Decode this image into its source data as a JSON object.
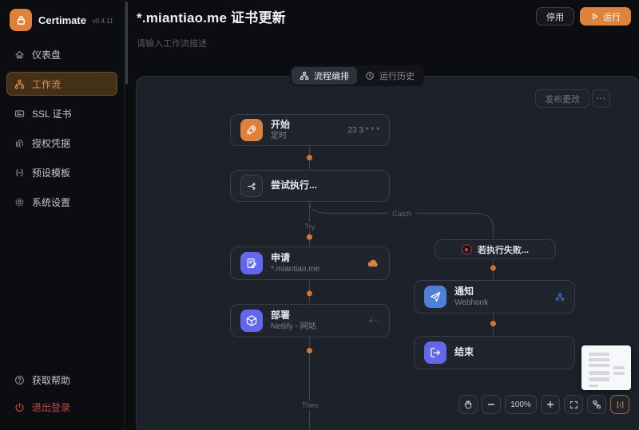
{
  "app": {
    "name": "Certimate",
    "version": "v0.4.11"
  },
  "sidebar": {
    "items": [
      {
        "label": "仪表盘",
        "icon": "home-icon",
        "active": false
      },
      {
        "label": "工作流",
        "icon": "workflow-icon",
        "active": true
      },
      {
        "label": "SSL 证书",
        "icon": "certificate-icon",
        "active": false
      },
      {
        "label": "授权凭据",
        "icon": "credentials-icon",
        "active": false
      },
      {
        "label": "预设模板",
        "icon": "template-icon",
        "active": false
      },
      {
        "label": "系统设置",
        "icon": "settings-icon",
        "active": false
      }
    ],
    "footer": [
      {
        "label": "获取帮助",
        "icon": "help-icon"
      },
      {
        "label": "退出登录",
        "icon": "logout-icon"
      }
    ]
  },
  "header": {
    "title": "*.miantiao.me 证书更新",
    "description": "请输入工作流描述",
    "disable_button": "停用",
    "run_button": "运行"
  },
  "tabs": [
    {
      "label": "流程编排",
      "active": true
    },
    {
      "label": "运行历史",
      "active": false
    }
  ],
  "canvas": {
    "publish_button": "发布更改",
    "more_button": "···",
    "zoom_level": "100%",
    "labels": {
      "try": "Try",
      "catch": "Catch",
      "then": "Then"
    },
    "nodes": {
      "start": {
        "title": "开始",
        "subtitle": "定时",
        "meta": "23 3 * * *"
      },
      "try_block": {
        "title": "尝试执行..."
      },
      "apply": {
        "title": "申请",
        "subtitle": "*.miantiao.me"
      },
      "deploy": {
        "title": "部署",
        "subtitle": "Netlify - 网站"
      },
      "on_failure": {
        "title": "若执行失败..."
      },
      "notify": {
        "title": "通知",
        "subtitle": "Webhook"
      },
      "end": {
        "title": "结束"
      }
    }
  },
  "colors": {
    "accent_orange": "#e0823a",
    "indigo_node": "#6366ef",
    "blue_node": "#4f80d9",
    "canvas_bg": "#1d212a",
    "sidebar_bg": "#0c0d10",
    "node_border": "#373d4a",
    "danger_red": "#c14b43",
    "edge_line": "#414856",
    "dot_orange": "#d0763c"
  }
}
